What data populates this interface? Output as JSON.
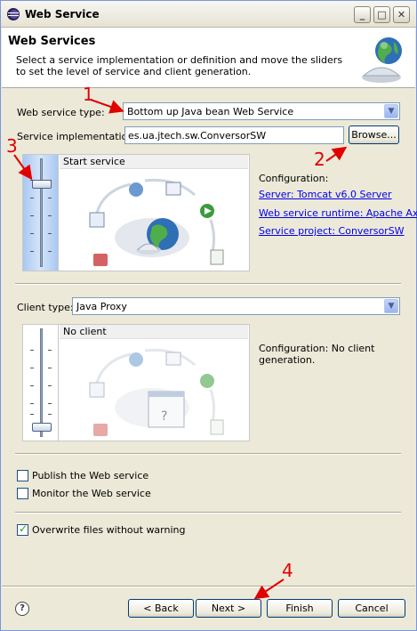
{
  "window": {
    "title": "Web Service",
    "controls": {
      "minimize": "_",
      "maximize": "□",
      "close": "✕"
    }
  },
  "banner": {
    "heading": "Web Services",
    "description": "Select a service implementation or definition and move the sliders to set the level of service and client generation."
  },
  "service": {
    "type_label": "Web service type:",
    "type_value": "Bottom up Java bean Web Service",
    "impl_label": "Service implementation:",
    "impl_value": "es.ua.jtech.sw.ConversorSW",
    "browse_label": "Browse...",
    "panel_caption": "Start service",
    "slider_level": "Start service",
    "configuration_title": "Configuration:",
    "links": {
      "server": "Server: Tomcat v6.0 Server",
      "runtime": "Web service runtime: Apache Axis",
      "project": "Service project: ConversorSW"
    }
  },
  "client": {
    "type_label": "Client type:",
    "type_value": "Java Proxy",
    "panel_caption": "No client",
    "slider_level": "No client",
    "configuration_text": "Configuration: No client generation."
  },
  "options": [
    {
      "label": "Publish the Web service",
      "checked": false
    },
    {
      "label": "Monitor the Web service",
      "checked": false
    }
  ],
  "overwrite": {
    "label": "Overwrite files without warning",
    "checked": true
  },
  "footer": {
    "help": "?",
    "back_label": "< Back",
    "next_label": "Next >",
    "finish_label": "Finish",
    "cancel_label": "Cancel"
  },
  "annotations": [
    "1",
    "2",
    "3",
    "4"
  ],
  "colors": {
    "annotation": "#e00000",
    "link": "#0000ee",
    "background": "#ece9d8"
  }
}
